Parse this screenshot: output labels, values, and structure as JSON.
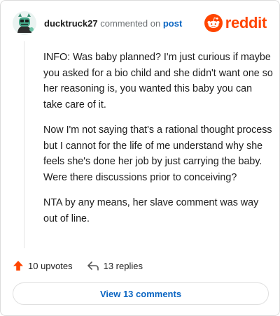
{
  "header": {
    "username": "ducktruck27",
    "commented_text": "commented on",
    "post_link": "post"
  },
  "brand": {
    "name": "reddit",
    "color": "#ff4500",
    "icon": "reddit-snoo-icon"
  },
  "comment": {
    "paragraphs": [
      "INFO: Was baby planned? I'm just curious if maybe you asked for a bio child and she didn't want one so her reasoning is, you wanted this baby you can take care of it.",
      "Now I'm not saying that's a rational thought process but I cannot for the life of me understand why she feels she's done her job by just carrying the baby. Were there discussions prior to conceiving?",
      "NTA by any means, her slave comment was way out of line."
    ]
  },
  "actions": {
    "upvotes": "10 upvotes",
    "upvote_icon": "upvote-arrow-icon",
    "replies": "13 replies",
    "reply_icon": "reply-arrow-icon"
  },
  "view_button": "View 13 comments",
  "colors": {
    "accent": "#ff4500",
    "link": "#0a65c2",
    "muted": "#6b6f72"
  }
}
